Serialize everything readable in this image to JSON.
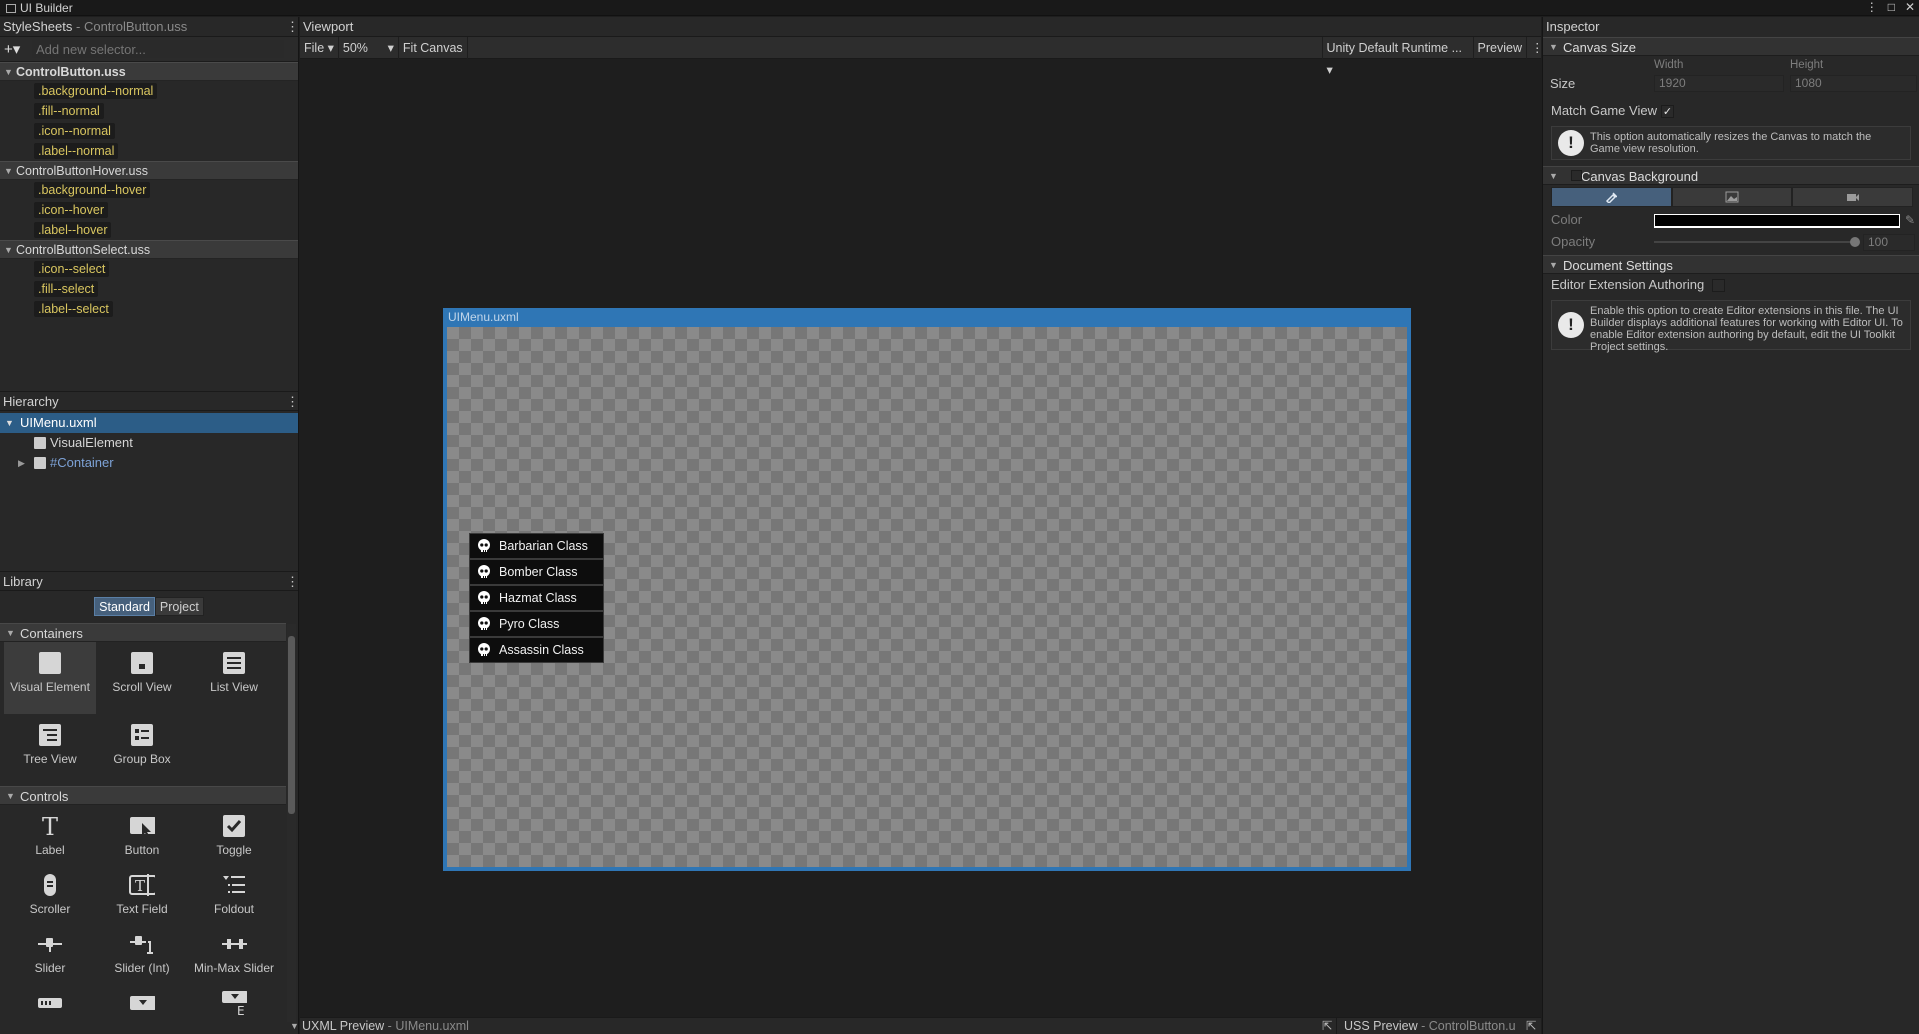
{
  "app": {
    "title": "UI Builder"
  },
  "stylesheets": {
    "header": "StyleSheets",
    "sub": "ControlButton.uss",
    "add_placeholder": "Add new selector...",
    "groups": [
      {
        "name": "ControlButton.uss",
        "selectors": [
          ".background--normal",
          ".fill--normal",
          ".icon--normal",
          ".label--normal"
        ]
      },
      {
        "name": "ControlButtonHover.uss",
        "selectors": [
          ".background--hover",
          ".icon--hover",
          ".label--hover"
        ]
      },
      {
        "name": "ControlButtonSelect.uss",
        "selectors": [
          ".icon--select",
          ".fill--select",
          ".label--select"
        ]
      }
    ]
  },
  "hierarchy": {
    "header": "Hierarchy",
    "root": "UIMenu.uxml",
    "items": [
      "VisualElement",
      "#Container"
    ]
  },
  "library": {
    "header": "Library",
    "tabs": [
      "Standard",
      "Project"
    ],
    "categories": [
      {
        "name": "Containers",
        "items": [
          "Visual Element",
          "Scroll View",
          "List View",
          "Tree View",
          "Group Box"
        ]
      },
      {
        "name": "Controls",
        "items": [
          "Label",
          "Button",
          "Toggle",
          "Scroller",
          "Text Field",
          "Foldout",
          "Slider",
          "Slider (Int)",
          "Min-Max Slider"
        ]
      }
    ]
  },
  "viewport": {
    "header": "Viewport",
    "toolbar": {
      "file": "File",
      "zoom": "50%",
      "fit": "Fit Canvas",
      "theme": "Unity Default Runtime ...",
      "preview": "Preview"
    },
    "canvas_title": "UIMenu.uxml",
    "menu_items": [
      "Barbarian Class",
      "Bomber Class",
      "Hazmat Class",
      "Pyro Class",
      "Assassin Class"
    ],
    "bottom": {
      "uxml_label": "UXML Preview",
      "uxml_file": "UIMenu.uxml",
      "uss_label": "USS Preview",
      "uss_file": "ControlButton.u"
    }
  },
  "inspector": {
    "header": "Inspector",
    "canvas_size": {
      "title": "Canvas Size",
      "size_label": "Size",
      "width_label": "Width",
      "height_label": "Height",
      "width": "1920",
      "height": "1080"
    },
    "match_game_view": {
      "label": "Match Game View",
      "checked": true,
      "help": "This option automatically resizes the Canvas to match the Game view resolution."
    },
    "canvas_background": {
      "title": "Canvas Background",
      "color_label": "Color",
      "color": "#000000",
      "opacity_label": "Opacity",
      "opacity": "100"
    },
    "document_settings": {
      "title": "Document Settings",
      "authoring_label": "Editor Extension Authoring",
      "help": "Enable this option to create Editor extensions in this file. The UI Builder displays additional features for working with Editor UI. To enable Editor extension authoring by default, edit the UI Toolkit Project settings."
    }
  }
}
